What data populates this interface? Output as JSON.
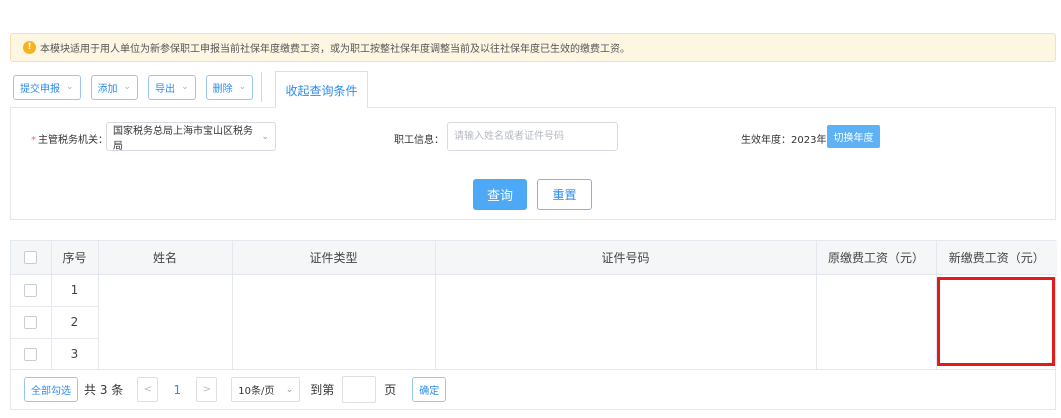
{
  "notice": {
    "icon": "warning-icon",
    "text": "本模块适用于用人单位为新参保职工申报当前社保年度缴费工资，或为职工按整社保年度调整当前及以往社保年度已生效的缴费工资。"
  },
  "toolbar": {
    "submit_label": "提交申报",
    "add_label": "添加",
    "export_label": "导出",
    "delete_label": "删除",
    "collapse_tab_label": "收起查询条件"
  },
  "search": {
    "tax_authority_label": "主管税务机关：",
    "tax_authority_value": "国家税务总局上海市宝山区税务局",
    "employee_info_label": "职工信息：",
    "employee_info_placeholder": "请输入姓名或者证件号码",
    "effective_year_text": "生效年度：2023年",
    "switch_year_label": "切换年度",
    "query_label": "查询",
    "reset_label": "重置"
  },
  "table": {
    "headers": {
      "seq": "序号",
      "name": "姓名",
      "id_type": "证件类型",
      "id_number": "证件号码",
      "orig_wage": "原缴费工资（元）",
      "new_wage": "新缴费工资（元）"
    },
    "rows": [
      {
        "seq": "1"
      },
      {
        "seq": "2"
      },
      {
        "seq": "3"
      }
    ]
  },
  "pager": {
    "select_all_label": "全部勾选",
    "total_text": "共 3 条",
    "prev": "<",
    "current_page": "1",
    "next": ">",
    "page_size": "10条/页",
    "goto_prefix": "到第",
    "goto_suffix": "页",
    "confirm_label": "确定"
  },
  "colors": {
    "accent": "#2d8cf0",
    "primary_button": "#4da8f5",
    "highlight": "#e21c1c",
    "notice_bg": "#fdf6e3"
  }
}
